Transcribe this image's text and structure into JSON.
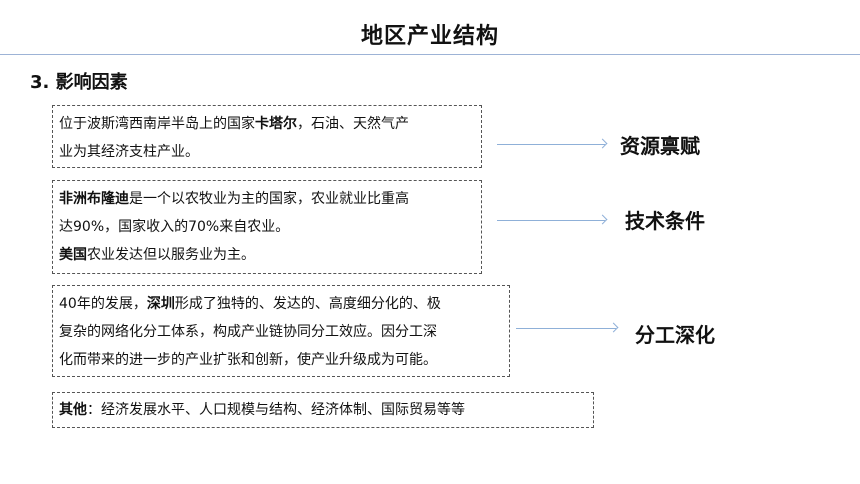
{
  "header": {
    "title": "地区产业结构"
  },
  "section": {
    "heading": "3. 影响因素"
  },
  "boxes": [
    {
      "line1_pre": "位于波斯湾西南岸半岛上的国家",
      "line1_bold": "卡塔尔",
      "line1_post": "，石油、天然气产",
      "line2": "业为其经济支柱产业。"
    },
    {
      "line1_bold": "非洲布隆迪",
      "line1_post": "是一个以农牧业为主的国家，农业就业比重高",
      "line2": "达90%，国家收入的70%来自农业。",
      "line3_bold": "美国",
      "line3_post": "农业发达但以服务业为主。"
    },
    {
      "line1_pre": "40年的发展，",
      "line1_bold": "深圳",
      "line1_post": "形成了独特的、发达的、高度细分化的、极",
      "line2": "复杂的网络化分工体系，构成产业链协同分工效应。因分工深",
      "line3": "化而带来的进一步的产业扩张和创新，使产业升级成为可能。"
    },
    {
      "bold": "其他",
      "post": "：经济发展水平、人口规模与结构、经济体制、国际贸易等等"
    }
  ],
  "labels": [
    "资源禀赋",
    "技术条件",
    "分工深化"
  ]
}
